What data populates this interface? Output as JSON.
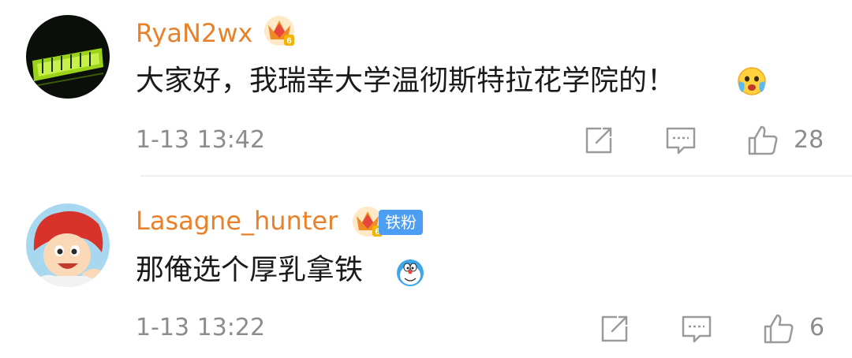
{
  "comments": [
    {
      "username": "RyaN2wx",
      "badge_icon": "crown-level-badge-icon",
      "badge_level": "6",
      "fan_tag": "",
      "text": "大家好，我瑞幸大学温彻斯特拉花学院的！",
      "emoji_icon": "crying-emoji-icon",
      "timestamp": "1-13 13:42",
      "like_count": "28"
    },
    {
      "username": "Lasagne_hunter",
      "badge_icon": "crown-level-badge-icon",
      "badge_level": "6",
      "fan_tag": "铁粉",
      "text": "那俺选个厚乳拿铁",
      "emoji_icon": "doraemon-emoji-icon",
      "timestamp": "1-13 13:22",
      "like_count": "6"
    }
  ],
  "colors": {
    "username": "#e8812a",
    "meta": "#8c8c8c",
    "fan_tag_bg": "#4b9ef2",
    "divider": "#eeeeee"
  }
}
